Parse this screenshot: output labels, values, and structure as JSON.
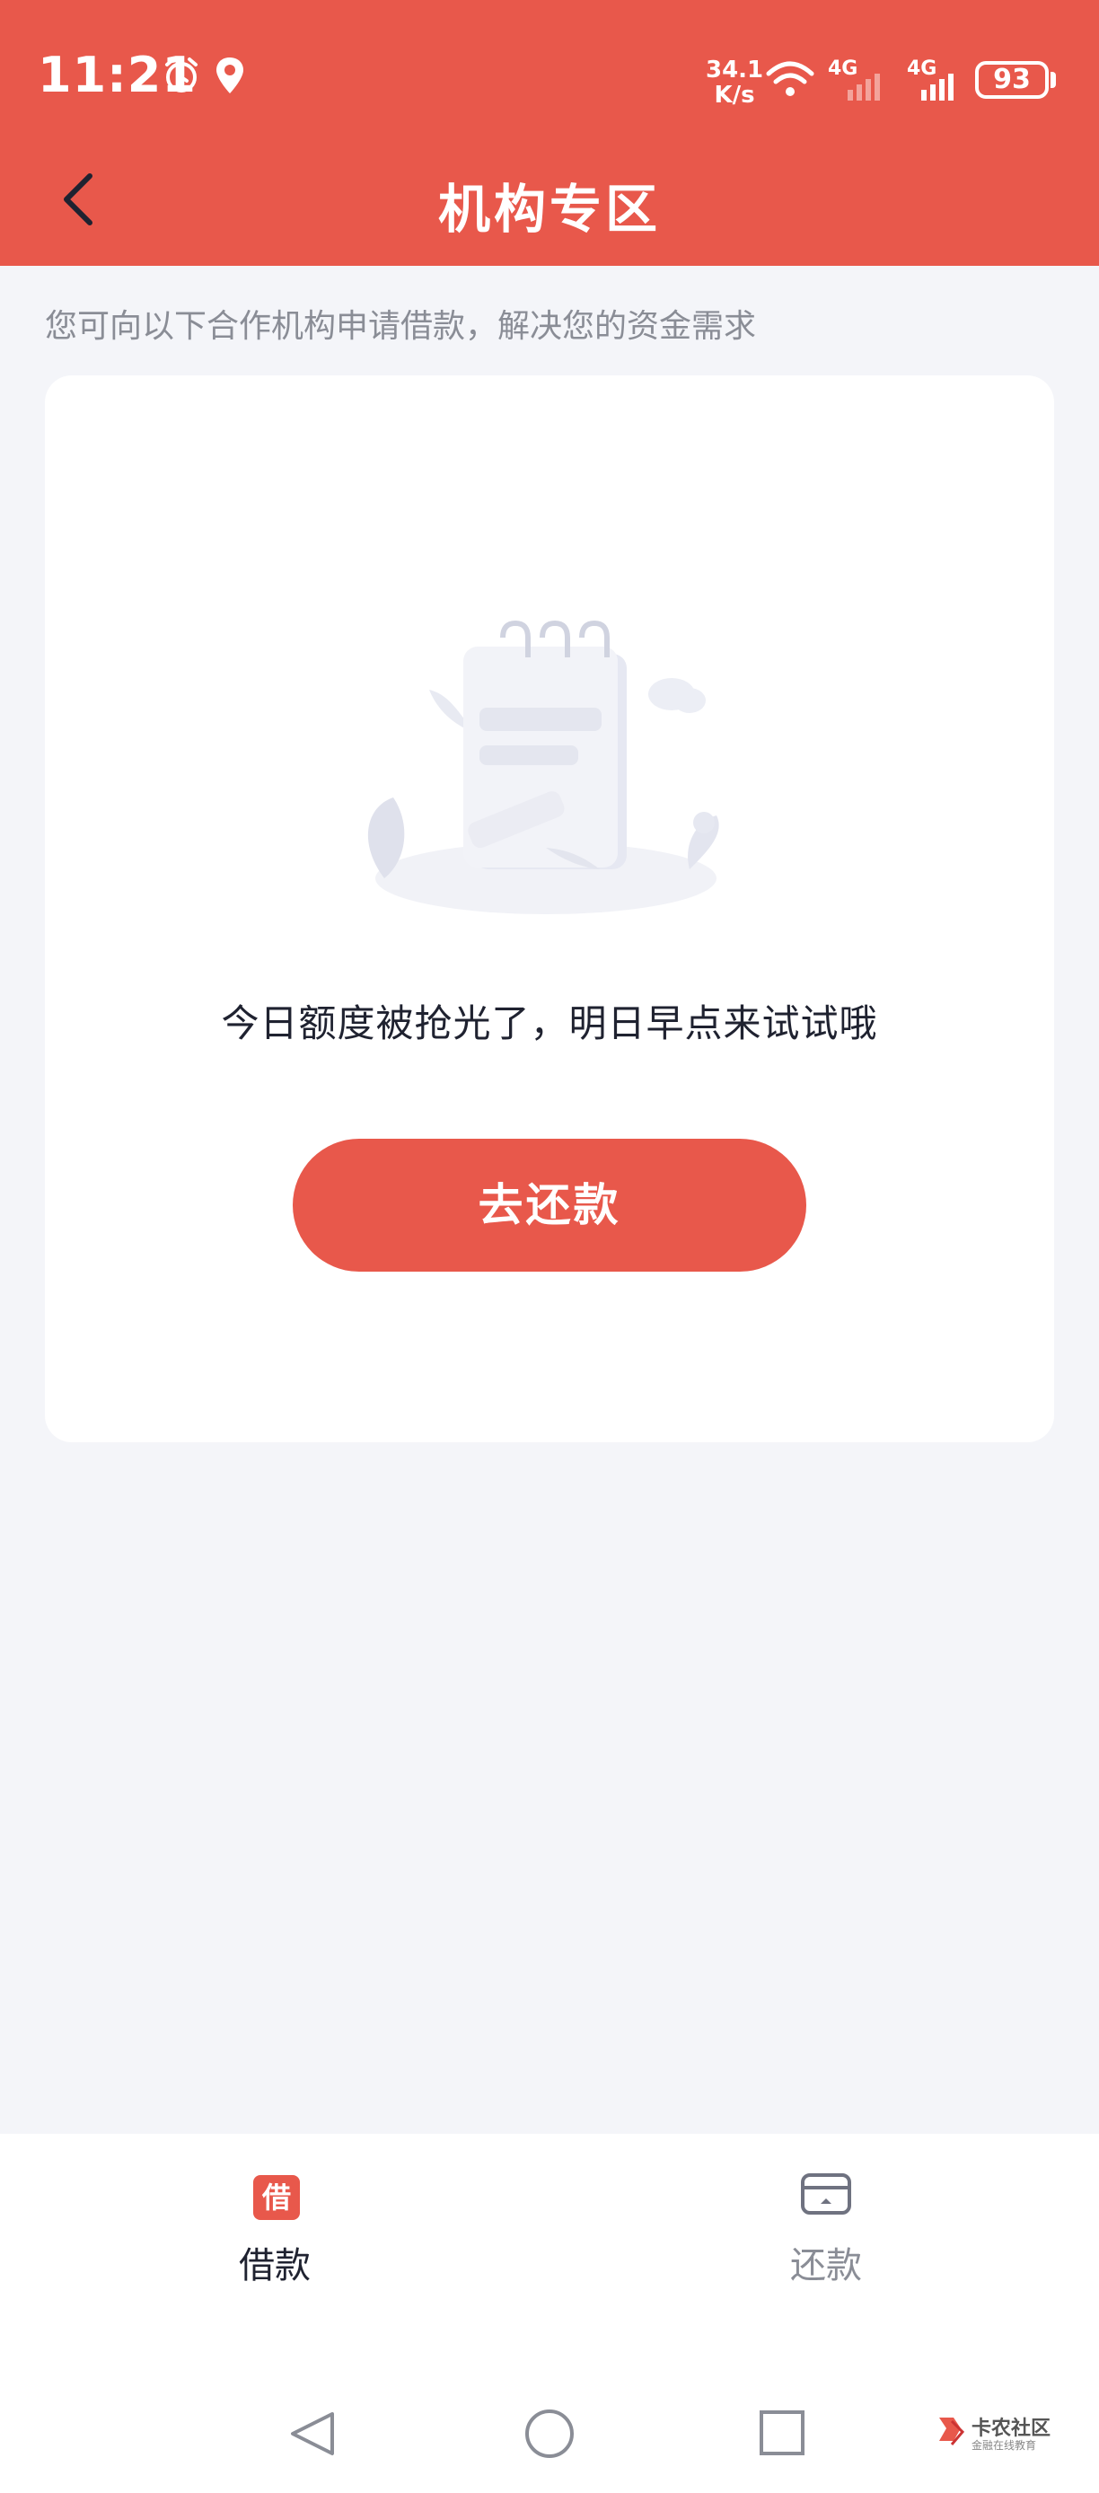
{
  "status_bar": {
    "time": "11:21",
    "net_speed_value": "34.1",
    "net_speed_unit": "K/s",
    "sim1_label": "4G",
    "sim2_label": "4G",
    "battery": "93"
  },
  "header": {
    "title": "机构专区",
    "back_icon": "chevron-left-icon"
  },
  "subtitle": "您可向以下合作机构申请借款，解决您的资金需求",
  "empty_state": {
    "illustration": "notebook-illustration",
    "message": "今日额度被抢光了，明日早点来试试哦",
    "button_label": "去还款"
  },
  "bottom_nav": {
    "tabs": [
      {
        "label": "借款",
        "icon_text": "借",
        "icon": "borrow-icon",
        "active": true
      },
      {
        "label": "还款",
        "icon": "card-icon",
        "active": false
      }
    ]
  },
  "watermark": {
    "text": "卡农社区",
    "sub": "金融在线教育"
  },
  "colors": {
    "accent": "#e8584b",
    "background": "#f4f5f9",
    "text_primary": "#1f2230",
    "text_secondary": "#8a8d96"
  }
}
